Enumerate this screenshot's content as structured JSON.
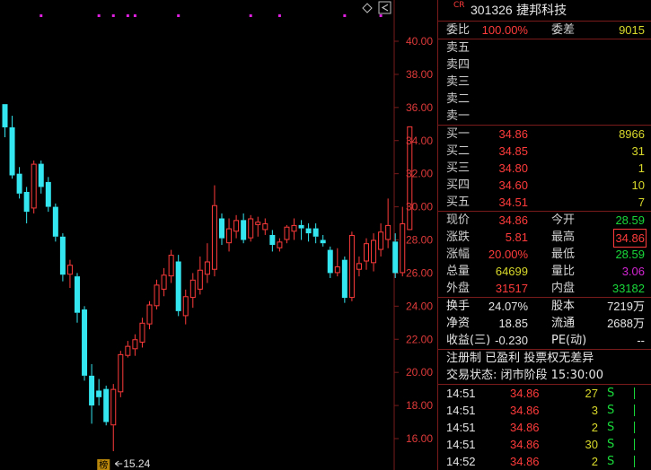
{
  "stock": {
    "code": "301326",
    "name": "捷邦科技",
    "badge": "CR"
  },
  "order_book": {
    "ratio_label": "委比",
    "ratio_value": "100.00%",
    "diff_label": "委差",
    "diff_value": "9015",
    "asks": [
      {
        "label": "卖五",
        "price": "",
        "vol": ""
      },
      {
        "label": "卖四",
        "price": "",
        "vol": ""
      },
      {
        "label": "卖三",
        "price": "",
        "vol": ""
      },
      {
        "label": "卖二",
        "price": "",
        "vol": ""
      },
      {
        "label": "卖一",
        "price": "",
        "vol": ""
      }
    ],
    "bids": [
      {
        "label": "买一",
        "price": "34.86",
        "vol": "8966"
      },
      {
        "label": "买二",
        "price": "34.85",
        "vol": "31"
      },
      {
        "label": "买三",
        "price": "34.80",
        "vol": "1"
      },
      {
        "label": "买四",
        "price": "34.60",
        "vol": "10"
      },
      {
        "label": "买五",
        "price": "34.51",
        "vol": "7"
      }
    ]
  },
  "quote": [
    {
      "l1": "现价",
      "v1": "34.86",
      "c1": "red",
      "l2": "今开",
      "v2": "28.59",
      "c2": "green",
      "boxed": false
    },
    {
      "l1": "涨跌",
      "v1": "5.81",
      "c1": "red",
      "l2": "最高",
      "v2": "34.86",
      "c2": "red",
      "boxed": true
    },
    {
      "l1": "涨幅",
      "v1": "20.00%",
      "c1": "red",
      "l2": "最低",
      "v2": "28.59",
      "c2": "green",
      "boxed": false
    },
    {
      "l1": "总量",
      "v1": "64699",
      "c1": "yellow",
      "l2": "量比",
      "v2": "3.06",
      "c2": "purple",
      "boxed": false
    },
    {
      "l1": "外盘",
      "v1": "31517",
      "c1": "red",
      "l2": "内盘",
      "v2": "33182",
      "c2": "green",
      "boxed": false
    }
  ],
  "fundamentals": [
    {
      "l1": "换手",
      "v1": "24.07%",
      "l2": "股本",
      "v2": "7219万"
    },
    {
      "l1": "净资",
      "v1": "18.85",
      "l2": "流通",
      "v2": "2688万"
    },
    {
      "l1": "收益(三)",
      "v1": "-0.230",
      "l2": "PE(动)",
      "v2": "--"
    }
  ],
  "info": {
    "tags": "注册制 已盈利 投票权无差异",
    "status_label": "交易状态:",
    "status_value": "闭市阶段 15:30:00"
  },
  "trades": [
    {
      "time": "14:51",
      "price": "34.86",
      "vol": "27",
      "side": "S"
    },
    {
      "time": "14:51",
      "price": "34.86",
      "vol": "3",
      "side": "S"
    },
    {
      "time": "14:51",
      "price": "34.86",
      "vol": "2",
      "side": "S"
    },
    {
      "time": "14:51",
      "price": "34.86",
      "vol": "30",
      "side": "S"
    },
    {
      "time": "14:52",
      "price": "34.86",
      "vol": "2",
      "side": "S"
    }
  ],
  "chart_data": {
    "type": "candlestick",
    "y_ticks": [
      "40.00",
      "38.00",
      "36.00",
      "34.00",
      "32.00",
      "30.00",
      "28.00",
      "26.00",
      "24.00",
      "22.00",
      "20.00",
      "18.00",
      "16.00"
    ],
    "ylim": [
      15.0,
      41.5
    ],
    "low_label": "15.24",
    "marker_label": "榜",
    "candles": [
      {
        "o": 36.2,
        "c": 34.8,
        "h": 36.2,
        "l": 34.2
      },
      {
        "o": 34.8,
        "c": 31.9,
        "h": 35.5,
        "l": 31.7
      },
      {
        "o": 32.0,
        "c": 30.8,
        "h": 32.4,
        "l": 30.5
      },
      {
        "o": 30.9,
        "c": 29.7,
        "h": 31.2,
        "l": 29.0
      },
      {
        "o": 29.9,
        "c": 32.6,
        "h": 32.8,
        "l": 29.6
      },
      {
        "o": 32.6,
        "c": 31.2,
        "h": 32.8,
        "l": 30.8
      },
      {
        "o": 31.5,
        "c": 30.0,
        "h": 31.8,
        "l": 29.7
      },
      {
        "o": 30.0,
        "c": 28.2,
        "h": 30.2,
        "l": 27.9
      },
      {
        "o": 28.2,
        "c": 25.9,
        "h": 28.4,
        "l": 25.5
      },
      {
        "o": 25.9,
        "c": 26.5,
        "h": 26.8,
        "l": 25.1
      },
      {
        "o": 25.8,
        "c": 23.6,
        "h": 26.0,
        "l": 23.0
      },
      {
        "o": 23.8,
        "c": 19.8,
        "h": 24.0,
        "l": 19.5
      },
      {
        "o": 19.8,
        "c": 18.0,
        "h": 20.5,
        "l": 16.9
      },
      {
        "o": 18.9,
        "c": 18.5,
        "h": 19.6,
        "l": 18.0
      },
      {
        "o": 19.0,
        "c": 17.0,
        "h": 19.2,
        "l": 16.8
      },
      {
        "o": 16.8,
        "c": 19.0,
        "h": 19.3,
        "l": 15.24
      },
      {
        "o": 18.8,
        "c": 21.1,
        "h": 21.3,
        "l": 18.5
      },
      {
        "o": 21.0,
        "c": 21.6,
        "h": 21.9,
        "l": 20.9
      },
      {
        "o": 21.4,
        "c": 22.0,
        "h": 22.3,
        "l": 21.0
      },
      {
        "o": 21.8,
        "c": 23.0,
        "h": 23.3,
        "l": 21.5
      },
      {
        "o": 22.9,
        "c": 24.1,
        "h": 24.3,
        "l": 22.6
      },
      {
        "o": 24.0,
        "c": 25.3,
        "h": 25.6,
        "l": 23.8
      },
      {
        "o": 25.0,
        "c": 25.9,
        "h": 26.3,
        "l": 24.6
      },
      {
        "o": 25.8,
        "c": 27.1,
        "h": 27.4,
        "l": 25.4
      },
      {
        "o": 26.7,
        "c": 23.7,
        "h": 27.1,
        "l": 23.4
      },
      {
        "o": 23.4,
        "c": 24.6,
        "h": 25.0,
        "l": 22.9
      },
      {
        "o": 24.5,
        "c": 25.6,
        "h": 26.0,
        "l": 23.9
      },
      {
        "o": 25.0,
        "c": 26.2,
        "h": 27.0,
        "l": 24.7
      },
      {
        "o": 25.9,
        "c": 26.7,
        "h": 27.8,
        "l": 25.4
      },
      {
        "o": 26.2,
        "c": 30.1,
        "h": 31.3,
        "l": 25.8
      },
      {
        "o": 29.3,
        "c": 28.1,
        "h": 29.6,
        "l": 27.7
      },
      {
        "o": 27.8,
        "c": 28.7,
        "h": 29.3,
        "l": 27.3
      },
      {
        "o": 28.5,
        "c": 29.2,
        "h": 29.5,
        "l": 28.1
      },
      {
        "o": 29.2,
        "c": 28.0,
        "h": 29.6,
        "l": 27.8
      },
      {
        "o": 28.1,
        "c": 29.3,
        "h": 29.5,
        "l": 27.9
      },
      {
        "o": 28.9,
        "c": 29.1,
        "h": 29.4,
        "l": 28.2
      },
      {
        "o": 28.6,
        "c": 29.0,
        "h": 29.3,
        "l": 28.3
      },
      {
        "o": 28.3,
        "c": 27.7,
        "h": 28.6,
        "l": 27.3
      },
      {
        "o": 27.5,
        "c": 27.9,
        "h": 28.1,
        "l": 27.3
      },
      {
        "o": 28.0,
        "c": 28.8,
        "h": 28.9,
        "l": 27.8
      },
      {
        "o": 28.5,
        "c": 28.9,
        "h": 29.3,
        "l": 28.0
      },
      {
        "o": 28.9,
        "c": 28.7,
        "h": 29.2,
        "l": 28.0
      },
      {
        "o": 28.7,
        "c": 28.4,
        "h": 29.0,
        "l": 27.9
      },
      {
        "o": 28.7,
        "c": 28.2,
        "h": 29.0,
        "l": 27.8
      },
      {
        "o": 28.0,
        "c": 27.8,
        "h": 28.3,
        "l": 27.6
      },
      {
        "o": 27.4,
        "c": 26.0,
        "h": 27.6,
        "l": 25.7
      },
      {
        "o": 26.0,
        "c": 26.4,
        "h": 27.5,
        "l": 25.8
      },
      {
        "o": 26.8,
        "c": 24.5,
        "h": 27.0,
        "l": 24.2
      },
      {
        "o": 24.5,
        "c": 28.3,
        "h": 28.5,
        "l": 24.3
      },
      {
        "o": 26.2,
        "c": 26.6,
        "h": 27.0,
        "l": 25.8
      },
      {
        "o": 26.7,
        "c": 27.8,
        "h": 28.1,
        "l": 26.2
      },
      {
        "o": 26.6,
        "c": 28.0,
        "h": 28.4,
        "l": 26.1
      },
      {
        "o": 27.4,
        "c": 28.5,
        "h": 29.0,
        "l": 27.0
      },
      {
        "o": 28.0,
        "c": 28.9,
        "h": 30.5,
        "l": 27.5
      },
      {
        "o": 27.9,
        "c": 26.0,
        "h": 28.4,
        "l": 25.7
      },
      {
        "o": 26.0,
        "c": 29.0,
        "h": 30.0,
        "l": 25.8
      },
      {
        "o": 28.6,
        "c": 34.86,
        "h": 34.86,
        "l": 28.59
      }
    ],
    "top_markers": [
      5,
      13,
      15,
      17,
      18,
      24,
      34,
      38,
      47,
      52
    ]
  }
}
